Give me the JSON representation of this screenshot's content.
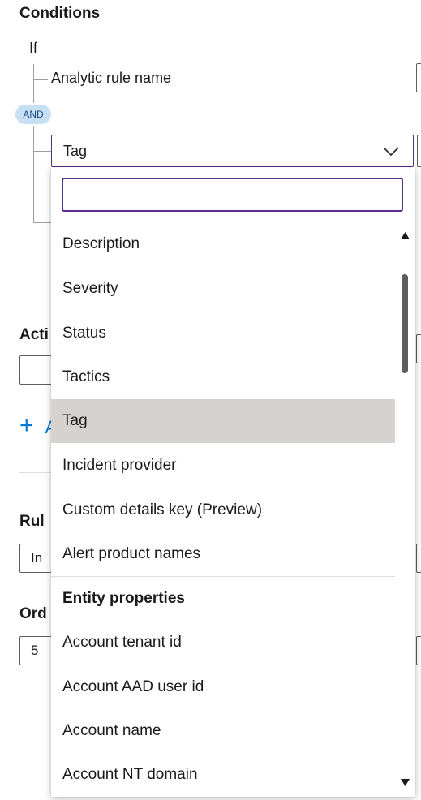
{
  "conditions": {
    "title": "Conditions",
    "if_label": "If",
    "condition_1_label": "Analytic rule name",
    "and_badge": "AND",
    "combo_value": "Tag"
  },
  "dropdown": {
    "search_value": "",
    "items": [
      {
        "label": "Description"
      },
      {
        "label": "Severity"
      },
      {
        "label": "Status"
      },
      {
        "label": "Tactics"
      },
      {
        "label": "Tag",
        "selected": true
      },
      {
        "label": "Incident provider"
      },
      {
        "label": "Custom details key (Preview)"
      },
      {
        "label": "Alert product names"
      }
    ],
    "group_header": "Entity properties",
    "entity_items": [
      {
        "label": "Account tenant id"
      },
      {
        "label": "Account AAD user id"
      },
      {
        "label": "Account name"
      },
      {
        "label": "Account NT domain"
      }
    ]
  },
  "background": {
    "actions_fragment": "Acti",
    "add_action_fragment": "A",
    "rule_fragment": "Rul",
    "rule_input_fragment": "In",
    "order_fragment": "Ord",
    "order_input_value": "5"
  },
  "colors": {
    "accent_focus": "#5c2d91",
    "and_badge_bg": "#c7e0f4",
    "selected_item_bg": "#d6d2cf",
    "link_blue": "#0078d4"
  },
  "icons": {
    "combo_chevron": "chevron-down-icon",
    "scroll_up": "scroll-up-arrow-icon",
    "scroll_down": "scroll-down-arrow-icon",
    "add": "plus-icon"
  }
}
